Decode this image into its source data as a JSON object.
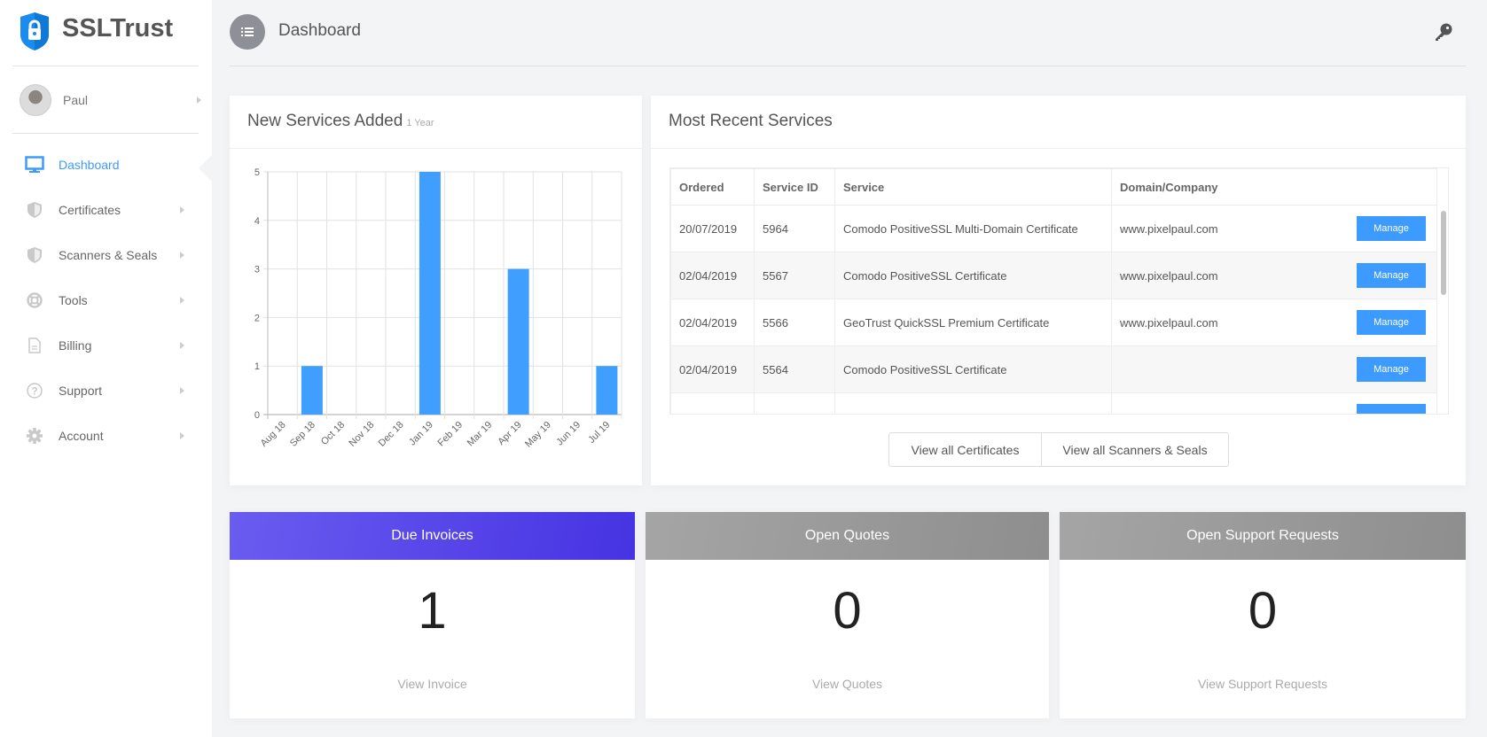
{
  "brand": {
    "name": "SSLTrust",
    "accent": "#3d9bff"
  },
  "user": {
    "name": "Paul"
  },
  "nav": [
    {
      "label": "Dashboard",
      "icon": "monitor-icon",
      "active": true
    },
    {
      "label": "Certificates",
      "icon": "shield-icon"
    },
    {
      "label": "Scanners & Seals",
      "icon": "shield-icon"
    },
    {
      "label": "Tools",
      "icon": "lifebuoy-icon"
    },
    {
      "label": "Billing",
      "icon": "document-icon"
    },
    {
      "label": "Support",
      "icon": "question-circle-icon"
    },
    {
      "label": "Account",
      "icon": "gear-icon"
    }
  ],
  "header": {
    "title": "Dashboard",
    "icon": "list-icon",
    "right_icon": "key-icon"
  },
  "services_chart": {
    "title": "New Services Added",
    "subtitle": "1 Year"
  },
  "chart_data": {
    "type": "bar",
    "categories": [
      "Aug 18",
      "Sep 18",
      "Oct 18",
      "Nov 18",
      "Dec 18",
      "Jan 19",
      "Feb 19",
      "Mar 19",
      "Apr 19",
      "May 19",
      "Jun 19",
      "Jul 19"
    ],
    "values": [
      0,
      1,
      0,
      0,
      0,
      5,
      0,
      0,
      3,
      0,
      0,
      1
    ],
    "ylim": [
      0,
      5
    ],
    "yticks": [
      0,
      1,
      2,
      3,
      4,
      5
    ],
    "grid": true,
    "color": "#409eff"
  },
  "recent": {
    "title": "Most Recent Services",
    "columns": [
      "Ordered",
      "Service ID",
      "Service",
      "Domain/Company"
    ],
    "rows": [
      {
        "ordered": "20/07/2019",
        "id": "5964",
        "service": "Comodo PositiveSSL Multi-Domain Certificate",
        "domain": "www.pixelpaul.com",
        "action": "Manage"
      },
      {
        "ordered": "02/04/2019",
        "id": "5567",
        "service": "Comodo PositiveSSL Certificate",
        "domain": "www.pixelpaul.com",
        "action": "Manage"
      },
      {
        "ordered": "02/04/2019",
        "id": "5566",
        "service": "GeoTrust QuickSSL Premium Certificate",
        "domain": "www.pixelpaul.com",
        "action": "Manage"
      },
      {
        "ordered": "02/04/2019",
        "id": "5564",
        "service": "Comodo PositiveSSL Certificate",
        "domain": "",
        "action": "Manage"
      }
    ],
    "view_certs": "View all Certificates",
    "view_scanners": "View all Scanners & Seals"
  },
  "stats": [
    {
      "title": "Due Invoices",
      "value": "1",
      "link": "View Invoice",
      "color": "#5b4de8"
    },
    {
      "title": "Open Quotes",
      "value": "0",
      "link": "View Quotes",
      "color": "#9a9a9a"
    },
    {
      "title": "Open Support Requests",
      "value": "0",
      "link": "View Support Requests",
      "color": "#9a9a9a"
    }
  ]
}
